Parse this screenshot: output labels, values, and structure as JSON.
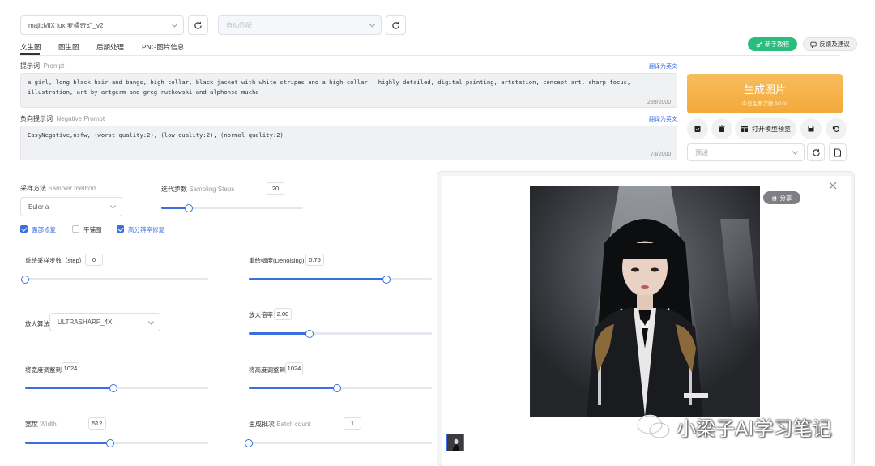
{
  "top": {
    "model_select": "majicMIX lux 麦橘奇幻_v2",
    "vae_select_placeholder": "自动匹配"
  },
  "tabs": [
    "文生图",
    "图生图",
    "后期处理",
    "PNG图片信息"
  ],
  "header_buttons": {
    "tutorial": "新手教程",
    "feedback": "反馈及建议"
  },
  "prompt": {
    "label_cn": "提示词",
    "label_en": "Prompt",
    "translate": "翻译为英文",
    "text": "a girl, long black hair and bangs, high collar, black jacket with white stripes and a high collar | highly detailed, digital painting, artstation, concept art, sharp focus, illustration, art by artgerm and greg rutkowski and alphonse mucha",
    "counter": "239/2000"
  },
  "negative_prompt": {
    "label_cn": "负向提示词",
    "label_en": "Negative Prompt",
    "translate": "翻译为英文",
    "text": "EasyNegative,nsfw, (worst quality:2), (low quality:2), (normal quality:2)",
    "counter": "73/2000"
  },
  "generate": {
    "label": "生成图片",
    "sub": "今日生图次数 9/100"
  },
  "actions": {
    "open_preview": "打开模型预览",
    "preset_placeholder": "预设"
  },
  "sampler": {
    "label_cn": "采样方法",
    "label_en": "Sampler method",
    "value": "Euler a"
  },
  "steps": {
    "label_cn": "迭代步数",
    "label_en": "Sampling Steps",
    "value": "20",
    "fraction": 0.17
  },
  "checks": [
    {
      "label": "面部修复",
      "checked": true
    },
    {
      "label": "平铺图",
      "checked": false
    },
    {
      "label": "高分辨率修复",
      "checked": true
    }
  ],
  "hires": {
    "redraw_steps": {
      "label": "重绘采样步数（step）",
      "value": "0",
      "fraction": 0.0
    },
    "denoising": {
      "label": "重绘幅度(Denoising)",
      "value": "0.75",
      "fraction": 0.75
    },
    "upscaler": {
      "label": "放大算法",
      "value": "ULTRASHARP_4X"
    },
    "upscale_by": {
      "label": "放大倍率",
      "value": "2.00",
      "fraction": 0.33
    },
    "resize_width": {
      "label": "将宽度调整到",
      "value": "1024",
      "fraction": 0.48
    },
    "resize_height": {
      "label": "将高度调整到",
      "value": "1024",
      "fraction": 0.48
    }
  },
  "width": {
    "label_cn": "宽度",
    "label_en": "Width",
    "value": "512",
    "fraction": 0.47
  },
  "batch_count": {
    "label_cn": "生成批次",
    "label_en": "Batch count",
    "value": "1",
    "fraction": 0.0
  },
  "output": {
    "share": "分享"
  },
  "watermark": "小梁子AI学习笔记",
  "colors": {
    "accent": "#3b6fe0",
    "generate_bg": "#f5b24a",
    "tutorial_green": "#2bbd7e"
  }
}
